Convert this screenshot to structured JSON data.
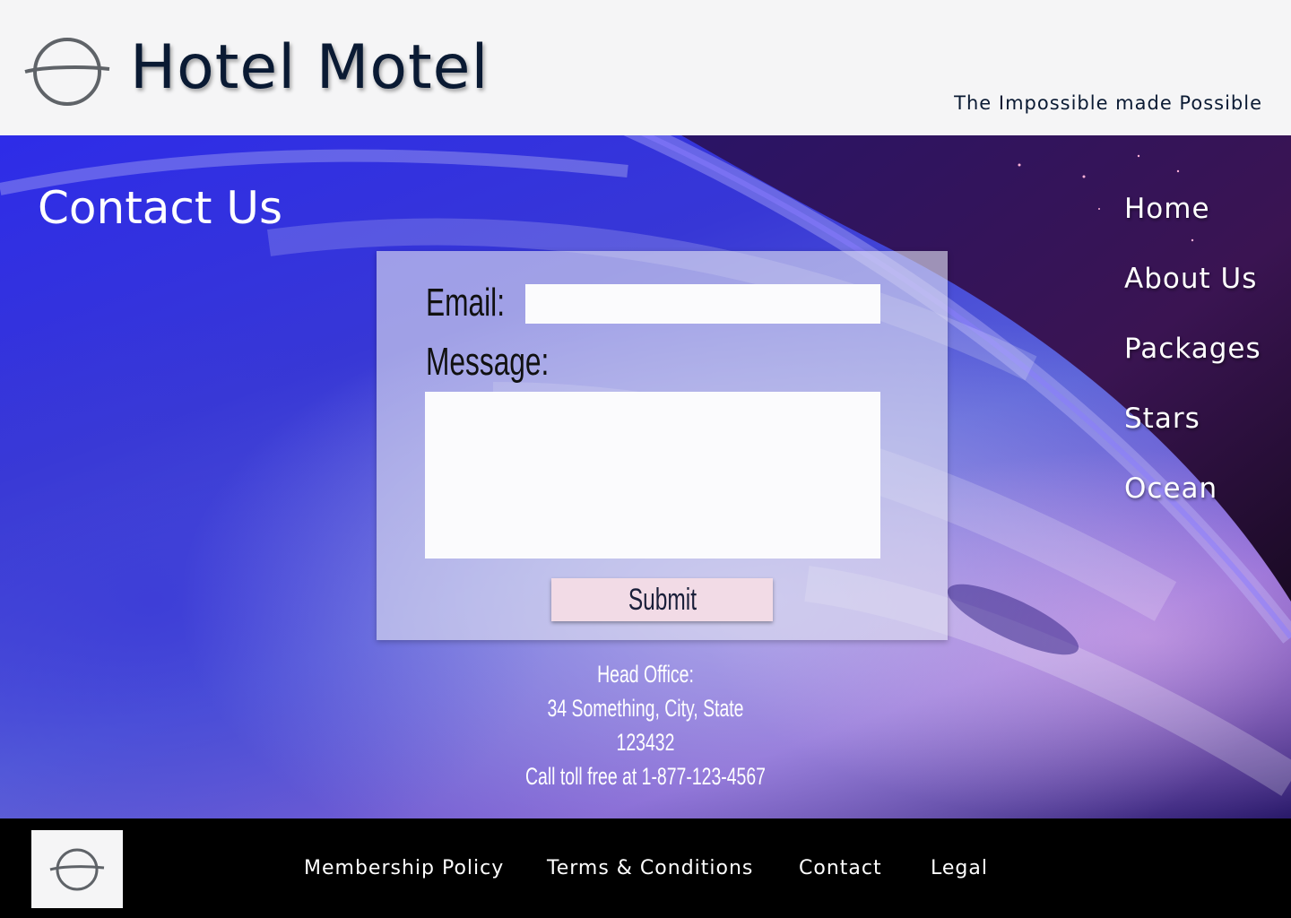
{
  "header": {
    "brand_name": "Hotel Motel",
    "tagline": "The Impossible made Possible",
    "logo_icon": "orbit-logo-icon"
  },
  "main": {
    "page_title": "Contact Us",
    "nav": {
      "items": [
        {
          "label": "Home"
        },
        {
          "label": "About Us"
        },
        {
          "label": "Packages"
        },
        {
          "label": "Stars"
        },
        {
          "label": "Ocean"
        }
      ]
    },
    "form": {
      "email_label": "Email:",
      "email_value": "",
      "message_label": "Message:",
      "message_value": "",
      "submit_label": "Submit"
    },
    "office": {
      "heading": "Head Office:",
      "address_line1": "34 Something, City, State",
      "address_line2": "123432",
      "phone_text": "Call toll free at 1-877-123-4567"
    }
  },
  "footer": {
    "links": [
      {
        "label": "Membership Policy"
      },
      {
        "label": "Terms & Conditions"
      },
      {
        "label": "Contact"
      },
      {
        "label": "Legal"
      }
    ]
  },
  "colors": {
    "header_bg": "#f5f5f6",
    "brand_text": "#0a1a33",
    "footer_bg": "#000000",
    "submit_bg": "#f2dbe6"
  }
}
